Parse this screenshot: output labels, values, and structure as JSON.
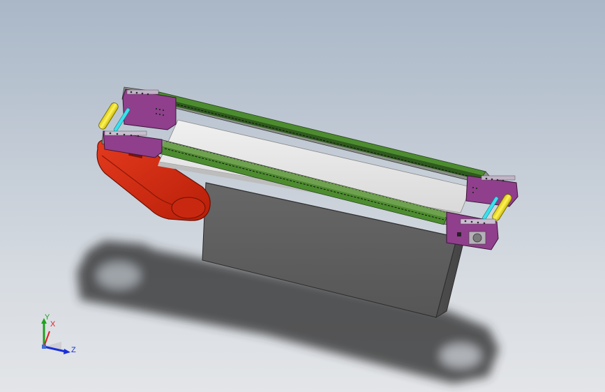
{
  "viewport": {
    "background_top": "#a9b7c7",
    "background_bottom": "#e3e5e8"
  },
  "model": {
    "parts": [
      {
        "name": "conveyor-frame",
        "color": "#9c9c9c"
      },
      {
        "name": "end-plate",
        "color": "#8b3d86"
      },
      {
        "name": "side-rail",
        "color": "#3c6a2a"
      },
      {
        "name": "belt-surface",
        "color": "#e6e6e6"
      },
      {
        "name": "roller",
        "color": "#f2e627"
      },
      {
        "name": "tension-rod",
        "color": "#35e4f0"
      },
      {
        "name": "drive-cover",
        "color": "#d42a10"
      },
      {
        "name": "base-box",
        "color": "#5e5e5e"
      }
    ]
  },
  "triad": {
    "x_label": "X",
    "y_label": "Y",
    "z_label": "Z",
    "x_color": "#e02020",
    "y_color": "#1fa01f",
    "z_color": "#1a2fd8"
  }
}
